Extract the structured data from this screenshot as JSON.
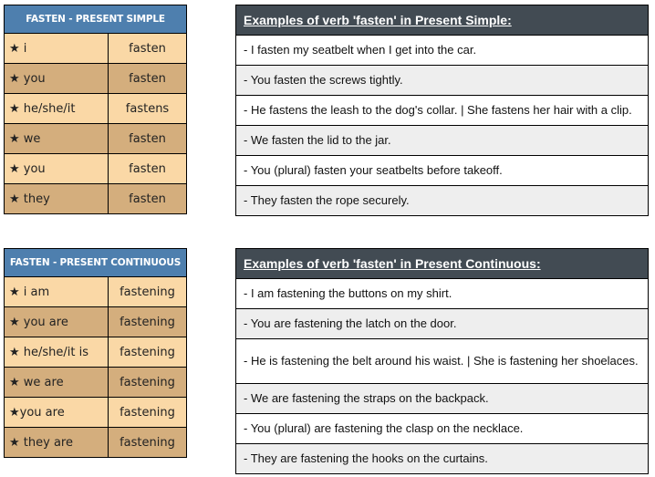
{
  "sections": [
    {
      "conjugation": {
        "title": "FASTEN - PRESENT SIMPLE",
        "rows": [
          {
            "pronoun": "★ i",
            "verb": "fasten"
          },
          {
            "pronoun": "★ you",
            "verb": "fasten"
          },
          {
            "pronoun": "★ he/she/it",
            "verb": "fastens"
          },
          {
            "pronoun": "★ we",
            "verb": "fasten"
          },
          {
            "pronoun": "★ you",
            "verb": "fasten"
          },
          {
            "pronoun": "★ they",
            "verb": "fasten"
          }
        ]
      },
      "examples": {
        "title": "Examples of verb 'fasten' in Present Simple:",
        "rows": [
          "- I fasten my seatbelt when I get into the car.",
          "- You fasten the screws tightly.",
          "- He fastens the leash to the dog's collar. | She fastens her hair with a clip.",
          "- We fasten the lid to the jar.",
          "- You (plural) fasten your seatbelts before takeoff.",
          "- They fasten the rope securely."
        ]
      }
    },
    {
      "conjugation": {
        "title": "FASTEN - PRESENT CONTINUOUS",
        "rows": [
          {
            "pronoun": "★ i am",
            "verb": "fastening"
          },
          {
            "pronoun": "★ you are",
            "verb": "fastening"
          },
          {
            "pronoun": "★ he/she/it is",
            "verb": "fastening"
          },
          {
            "pronoun": "★ we are",
            "verb": "fastening"
          },
          {
            "pronoun": "★you are",
            "verb": "fastening"
          },
          {
            "pronoun": "★ they are",
            "verb": "fastening"
          }
        ]
      },
      "examples": {
        "title": "Examples of verb 'fasten' in Present Continuous:",
        "rows": [
          "- I am fastening the buttons on my shirt.",
          "- You are fastening the latch on the door.",
          "- He is fastening the belt around his waist. | She is fastening her shoelaces.",
          "- We are fastening the straps on the backpack.",
          "- You (plural) are fastening the clasp on the necklace.",
          "- They are fastening the hooks on the curtains."
        ]
      }
    }
  ],
  "colors": {
    "conj_header": "#4e7fae",
    "conj_row_light": "#fad8a6",
    "conj_row_dark": "#d4ae7d",
    "examples_header": "#424b53",
    "examples_row_alt": "#eeeeee"
  }
}
